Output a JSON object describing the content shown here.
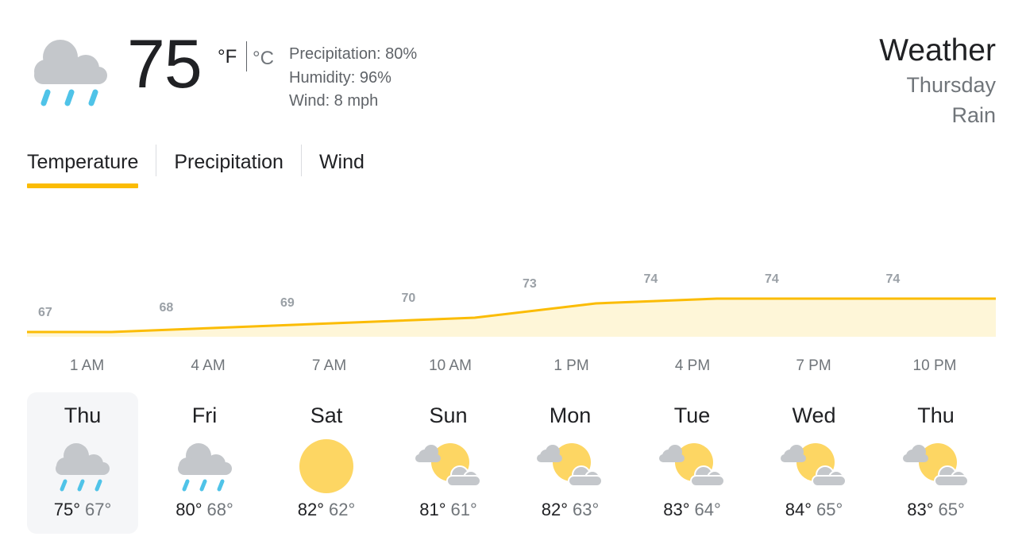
{
  "current": {
    "temp": "75",
    "unit_f": "°F",
    "unit_c": "°C",
    "icon": "rain-icon",
    "details": [
      "Precipitation: 80%",
      "Humidity: 96%",
      "Wind: 8 mph"
    ]
  },
  "header": {
    "title": "Weather",
    "day": "Thursday",
    "condition": "Rain"
  },
  "tabs": [
    {
      "label": "Temperature",
      "active": true
    },
    {
      "label": "Precipitation",
      "active": false
    },
    {
      "label": "Wind",
      "active": false
    }
  ],
  "colors": {
    "accent": "#fbbc04",
    "fill": "#fef6d8",
    "cloud": "#c4c7cb",
    "rain": "#4fc3e8",
    "sun": "#fdd663"
  },
  "chart_data": {
    "type": "area",
    "x": [
      "1 AM",
      "4 AM",
      "7 AM",
      "10 AM",
      "1 PM",
      "4 PM",
      "7 PM",
      "10 PM"
    ],
    "series": [
      {
        "values": [
          67,
          68,
          69,
          70,
          73,
          74,
          74,
          74
        ]
      }
    ],
    "labels": [
      "67",
      "68",
      "69",
      "70",
      "73",
      "74",
      "74",
      "74"
    ],
    "ylim": [
      60,
      80
    ],
    "grid": false
  },
  "forecast": [
    {
      "day": "Thu",
      "icon": "rain-icon",
      "high": "75°",
      "low": "67°",
      "selected": true
    },
    {
      "day": "Fri",
      "icon": "rain-icon",
      "high": "80°",
      "low": "68°",
      "selected": false
    },
    {
      "day": "Sat",
      "icon": "sun-icon",
      "high": "82°",
      "low": "62°",
      "selected": false
    },
    {
      "day": "Sun",
      "icon": "partly-cloudy-icon",
      "high": "81°",
      "low": "61°",
      "selected": false
    },
    {
      "day": "Mon",
      "icon": "partly-cloudy-icon",
      "high": "82°",
      "low": "63°",
      "selected": false
    },
    {
      "day": "Tue",
      "icon": "partly-cloudy-icon",
      "high": "83°",
      "low": "64°",
      "selected": false
    },
    {
      "day": "Wed",
      "icon": "partly-cloudy-icon",
      "high": "84°",
      "low": "65°",
      "selected": false
    },
    {
      "day": "Thu",
      "icon": "partly-cloudy-icon",
      "high": "83°",
      "low": "65°",
      "selected": false
    }
  ]
}
